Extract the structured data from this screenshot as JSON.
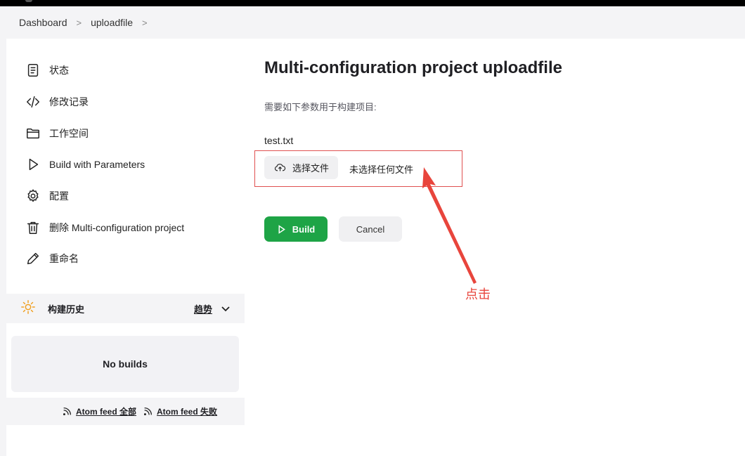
{
  "breadcrumb": {
    "items": [
      "Dashboard",
      "uploadfile"
    ],
    "separator": ">"
  },
  "sidebar": {
    "items": [
      {
        "label": "状态",
        "icon": "document-icon"
      },
      {
        "label": "修改记录",
        "icon": "code-icon"
      },
      {
        "label": "工作空间",
        "icon": "folder-icon"
      },
      {
        "label": "Build with Parameters",
        "icon": "play-icon"
      },
      {
        "label": "配置",
        "icon": "gear-icon"
      },
      {
        "label": "删除 Multi-configuration project",
        "icon": "trash-icon"
      },
      {
        "label": "重命名",
        "icon": "pencil-icon"
      }
    ]
  },
  "history": {
    "title": "构建历史",
    "trend_label": "趋势",
    "empty_text": "No builds",
    "feeds": [
      {
        "label": "Atom feed 全部"
      },
      {
        "label": "Atom feed 失败"
      }
    ]
  },
  "main": {
    "title": "Multi-configuration project uploadfile",
    "description": "需要如下参数用于构建项目:",
    "param_name": "test.txt",
    "file_button_label": "选择文件",
    "file_status": "未选择任何文件",
    "build_label": "Build",
    "cancel_label": "Cancel"
  },
  "annotation": {
    "text": "点击",
    "color": "#e8453c"
  },
  "colors": {
    "build_green": "#1ea446",
    "highlight_red": "#e05050"
  }
}
